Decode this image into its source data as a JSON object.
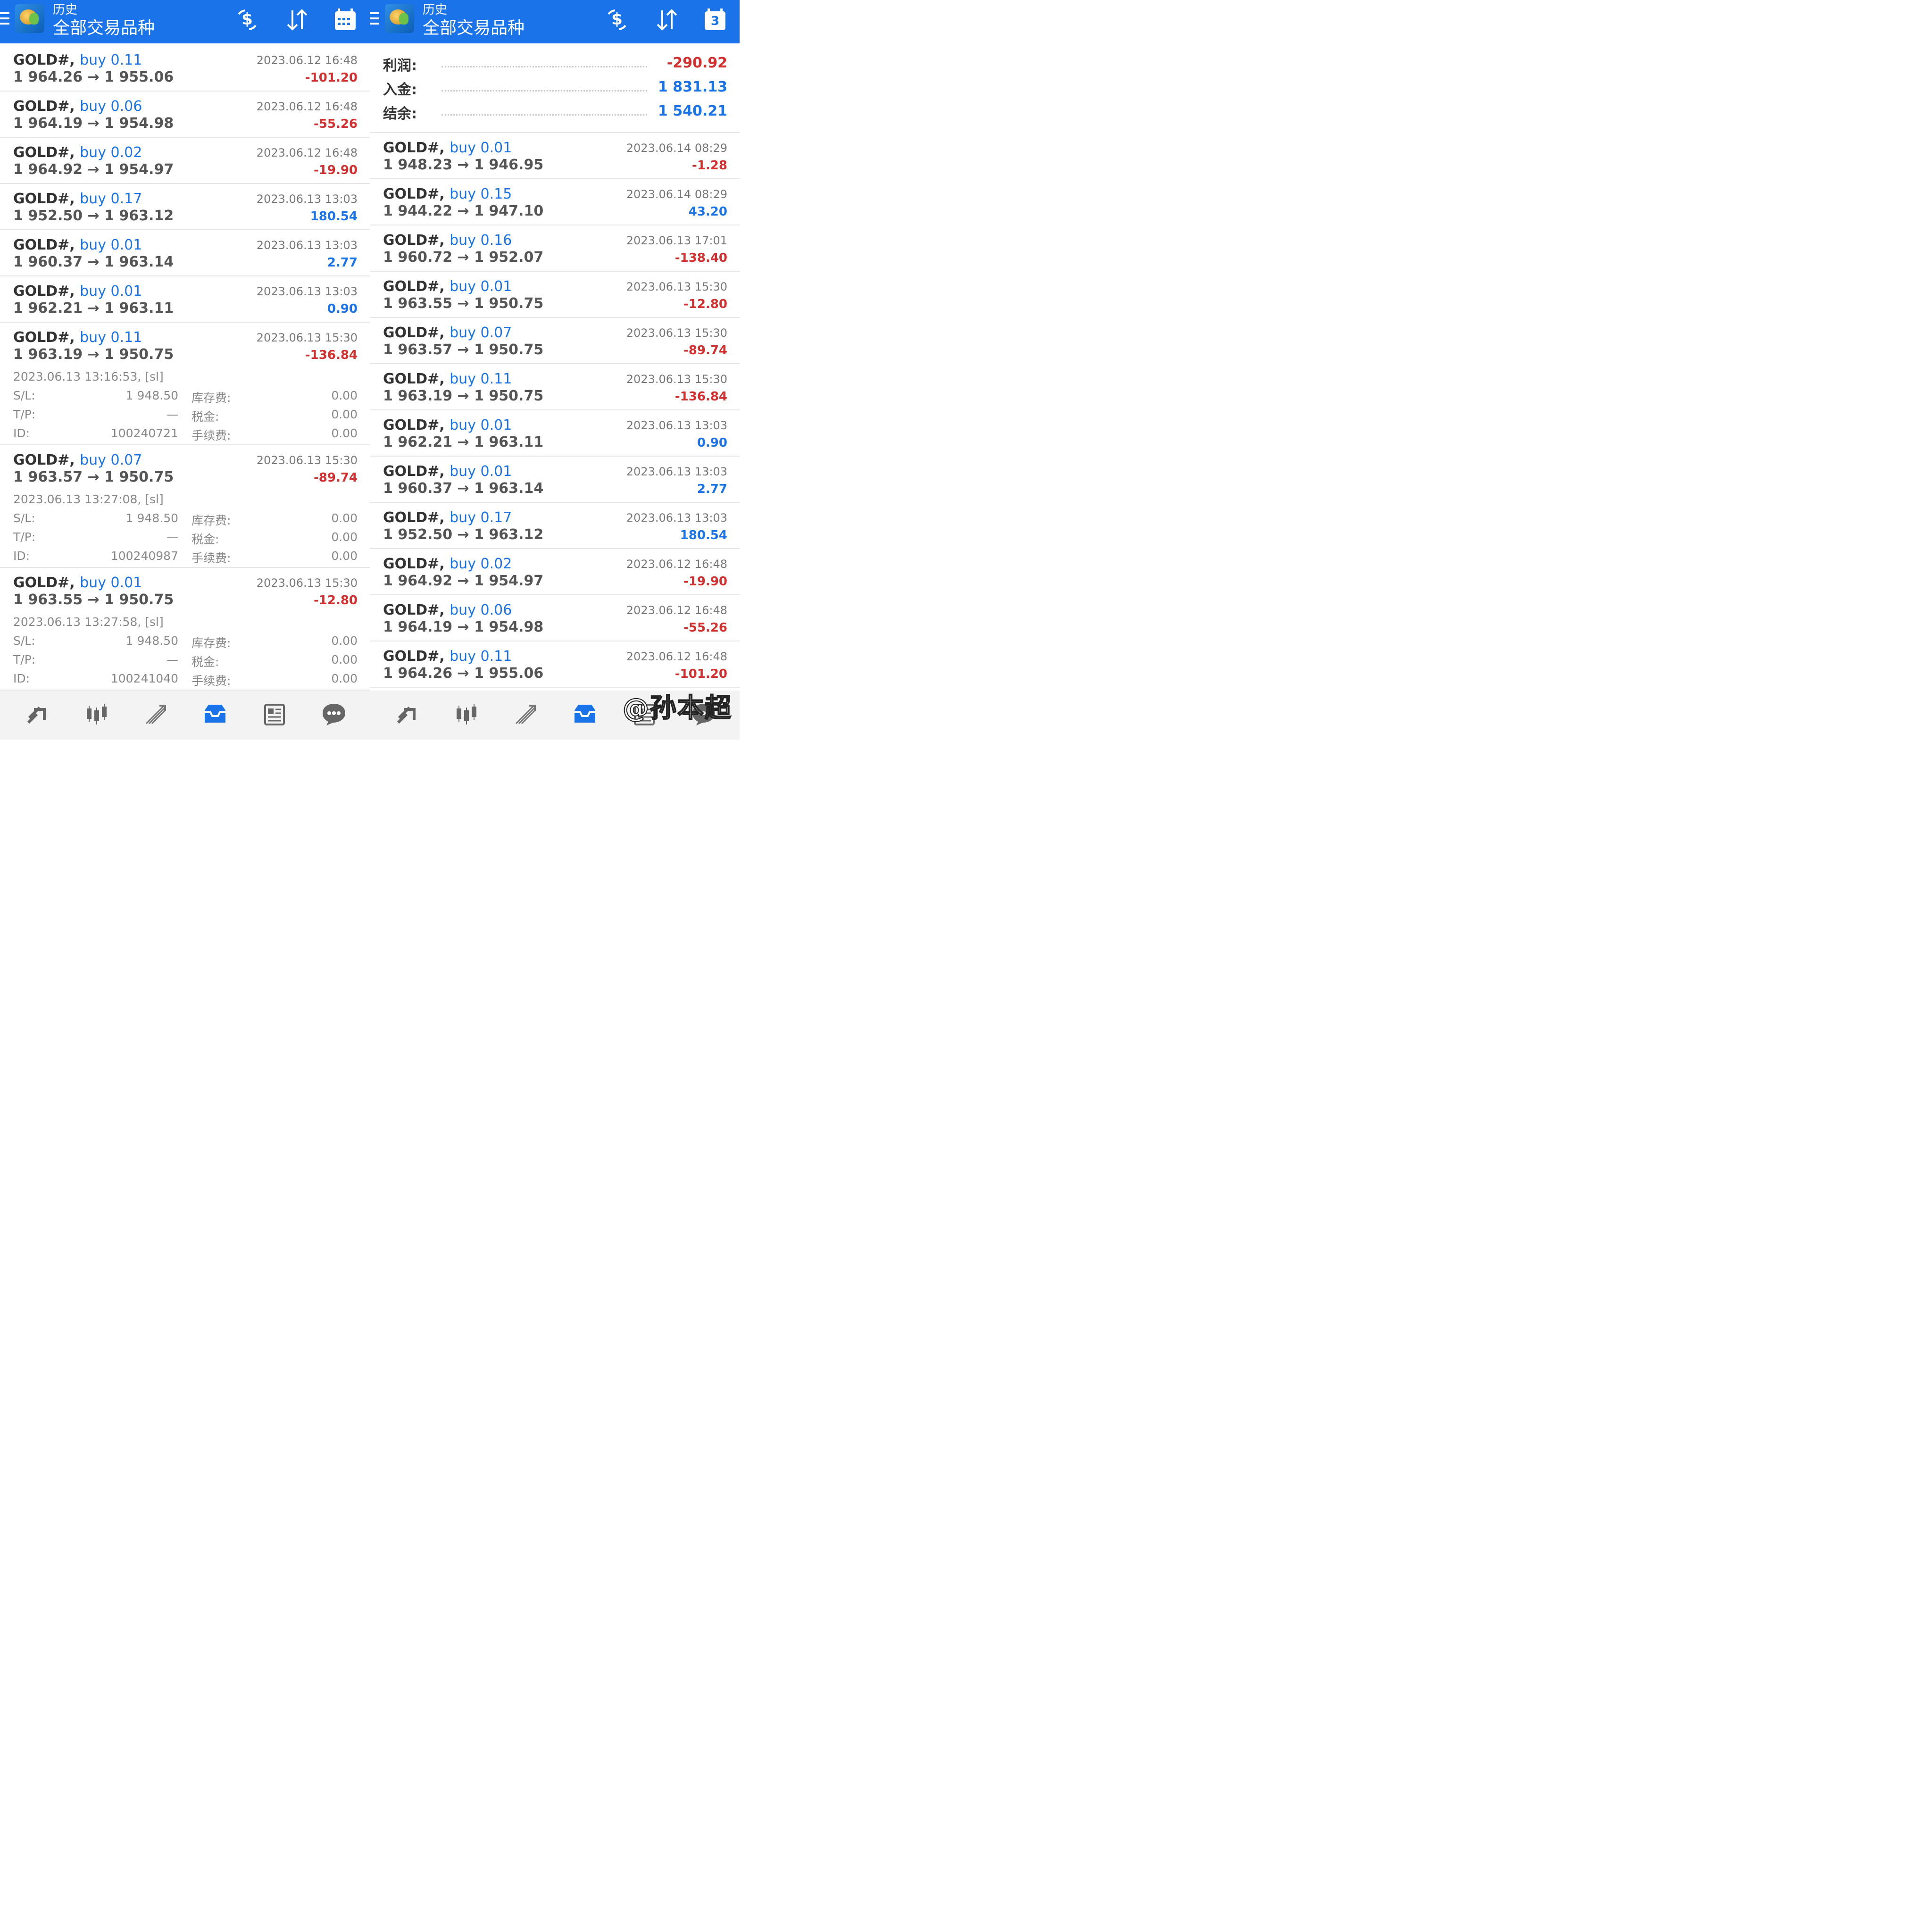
{
  "header": {
    "title_small": "历史",
    "title_big": "全部交易品种",
    "calendar_day": "3"
  },
  "colors": {
    "accent": "#1a73e8",
    "negative": "#d32f2f",
    "positive": "#1a73e8"
  },
  "left": {
    "rows": [
      {
        "sym": "GOLD#,",
        "buy": "buy 0.11",
        "prices": "1 964.26 → 1 955.06",
        "time": "2023.06.12 16:48",
        "profit": "-101.20",
        "neg": true
      },
      {
        "sym": "GOLD#,",
        "buy": "buy 0.06",
        "prices": "1 964.19 → 1 954.98",
        "time": "2023.06.12 16:48",
        "profit": "-55.26",
        "neg": true
      },
      {
        "sym": "GOLD#,",
        "buy": "buy 0.02",
        "prices": "1 964.92 → 1 954.97",
        "time": "2023.06.12 16:48",
        "profit": "-19.90",
        "neg": true
      },
      {
        "sym": "GOLD#,",
        "buy": "buy 0.17",
        "prices": "1 952.50 → 1 963.12",
        "time": "2023.06.13 13:03",
        "profit": "180.54",
        "neg": false
      },
      {
        "sym": "GOLD#,",
        "buy": "buy 0.01",
        "prices": "1 960.37 → 1 963.14",
        "time": "2023.06.13 13:03",
        "profit": "2.77",
        "neg": false
      },
      {
        "sym": "GOLD#,",
        "buy": "buy 0.01",
        "prices": "1 962.21 → 1 963.11",
        "time": "2023.06.13 13:03",
        "profit": "0.90",
        "neg": false
      },
      {
        "sym": "GOLD#,",
        "buy": "buy 0.11",
        "prices": "1 963.19 → 1 950.75",
        "time": "2023.06.13 15:30",
        "profit": "-136.84",
        "neg": true,
        "detail": {
          "open_time": "2023.06.13 13:16:53, [sl]",
          "sl_label": "S/L:",
          "sl": "1 948.50",
          "tp_label": "T/P:",
          "tp": "—",
          "id_label": "ID:",
          "id": "100240721",
          "swap_label": "库存费:",
          "swap": "0.00",
          "tax_label": "税金:",
          "tax": "0.00",
          "fee_label": "手续费:",
          "fee": "0.00"
        }
      },
      {
        "sym": "GOLD#,",
        "buy": "buy 0.07",
        "prices": "1 963.57 → 1 950.75",
        "time": "2023.06.13 15:30",
        "profit": "-89.74",
        "neg": true,
        "detail": {
          "open_time": "2023.06.13 13:27:08, [sl]",
          "sl_label": "S/L:",
          "sl": "1 948.50",
          "tp_label": "T/P:",
          "tp": "—",
          "id_label": "ID:",
          "id": "100240987",
          "swap_label": "库存费:",
          "swap": "0.00",
          "tax_label": "税金:",
          "tax": "0.00",
          "fee_label": "手续费:",
          "fee": "0.00"
        }
      },
      {
        "sym": "GOLD#,",
        "buy": "buy 0.01",
        "prices": "1 963.55 → 1 950.75",
        "time": "2023.06.13 15:30",
        "profit": "-12.80",
        "neg": true,
        "detail": {
          "open_time": "2023.06.13 13:27:58, [sl]",
          "sl_label": "S/L:",
          "sl": "1 948.50",
          "tp_label": "T/P:",
          "tp": "—",
          "id_label": "ID:",
          "id": "100241040",
          "swap_label": "库存费:",
          "swap": "0.00",
          "tax_label": "税金:",
          "tax": "0.00",
          "fee_label": "手续费:",
          "fee": "0.00"
        }
      }
    ]
  },
  "right": {
    "summary": [
      {
        "label": "利润:",
        "value": "-290.92",
        "neg": true
      },
      {
        "label": "入金:",
        "value": "1 831.13",
        "neg": false
      },
      {
        "label": "结余:",
        "value": "1 540.21",
        "neg": false
      }
    ],
    "rows": [
      {
        "sym": "GOLD#,",
        "buy": "buy 0.01",
        "prices": "1 948.23 → 1 946.95",
        "time": "2023.06.14 08:29",
        "profit": "-1.28",
        "neg": true
      },
      {
        "sym": "GOLD#,",
        "buy": "buy 0.15",
        "prices": "1 944.22 → 1 947.10",
        "time": "2023.06.14 08:29",
        "profit": "43.20",
        "neg": false
      },
      {
        "sym": "GOLD#,",
        "buy": "buy 0.16",
        "prices": "1 960.72 → 1 952.07",
        "time": "2023.06.13 17:01",
        "profit": "-138.40",
        "neg": true
      },
      {
        "sym": "GOLD#,",
        "buy": "buy 0.01",
        "prices": "1 963.55 → 1 950.75",
        "time": "2023.06.13 15:30",
        "profit": "-12.80",
        "neg": true
      },
      {
        "sym": "GOLD#,",
        "buy": "buy 0.07",
        "prices": "1 963.57 → 1 950.75",
        "time": "2023.06.13 15:30",
        "profit": "-89.74",
        "neg": true
      },
      {
        "sym": "GOLD#,",
        "buy": "buy 0.11",
        "prices": "1 963.19 → 1 950.75",
        "time": "2023.06.13 15:30",
        "profit": "-136.84",
        "neg": true
      },
      {
        "sym": "GOLD#,",
        "buy": "buy 0.01",
        "prices": "1 962.21 → 1 963.11",
        "time": "2023.06.13 13:03",
        "profit": "0.90",
        "neg": false
      },
      {
        "sym": "GOLD#,",
        "buy": "buy 0.01",
        "prices": "1 960.37 → 1 963.14",
        "time": "2023.06.13 13:03",
        "profit": "2.77",
        "neg": false
      },
      {
        "sym": "GOLD#,",
        "buy": "buy 0.17",
        "prices": "1 952.50 → 1 963.12",
        "time": "2023.06.13 13:03",
        "profit": "180.54",
        "neg": false
      },
      {
        "sym": "GOLD#,",
        "buy": "buy 0.02",
        "prices": "1 964.92 → 1 954.97",
        "time": "2023.06.12 16:48",
        "profit": "-19.90",
        "neg": true
      },
      {
        "sym": "GOLD#,",
        "buy": "buy 0.06",
        "prices": "1 964.19 → 1 954.98",
        "time": "2023.06.12 16:48",
        "profit": "-55.26",
        "neg": true
      },
      {
        "sym": "GOLD#,",
        "buy": "buy 0.11",
        "prices": "1 964.26 → 1 955.06",
        "time": "2023.06.12 16:48",
        "profit": "-101.20",
        "neg": true
      }
    ]
  },
  "bottom_nav": [
    "quotes-icon",
    "chart-icon",
    "trade-icon",
    "history-icon",
    "news-icon",
    "chat-icon"
  ],
  "watermark": "@孙本超"
}
